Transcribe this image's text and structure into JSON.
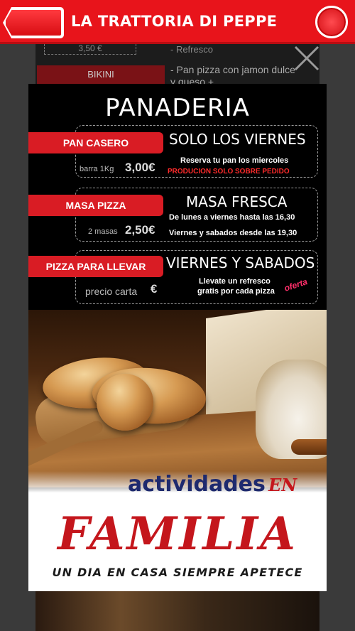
{
  "app": {
    "title": "LA TRATTORIA DI PEPPE"
  },
  "background_page": {
    "price_row": "3,50 €",
    "price_row_desc": "- Refresco",
    "item_name": "BIKINI",
    "item_desc": "- Pan pizza con jamon dulce y queso +"
  },
  "poster": {
    "title": "PANADERIA",
    "sections": [
      {
        "tag": "PAN CASERO",
        "heading": "SOLO LOS VIERNES",
        "lines": [
          "Reserva tu pan los miercoles"
        ],
        "highlight": "PRODUCION SOLO SOBRE PEDIDO",
        "price_label": "barra 1Kg",
        "price": "3,00€"
      },
      {
        "tag": "MASA PIZZA",
        "heading": "MASA FRESCA",
        "lines": [
          "De lunes a viernes hasta las 16,30",
          "Viernes y sabados desde las 19,30"
        ],
        "price_label": "2 masas",
        "price": "2,50€"
      },
      {
        "tag": "PIZZA PARA LLEVAR",
        "heading": "VIERNES Y SABADOS",
        "lines": [
          "Llevate un refresco",
          "gratis por cada pizza"
        ],
        "badge": "oferta",
        "price_label": "precio carta",
        "price": "€"
      }
    ],
    "ad": {
      "line1": "actividades",
      "line1_accent": "EN",
      "headline": "FAMILIA",
      "tagline": "UN DIA EN CASA SIEMPRE APETECE"
    }
  },
  "colors": {
    "brand_red": "#e8141b",
    "tag_red": "#d91c24",
    "navy": "#1e2a6e"
  }
}
